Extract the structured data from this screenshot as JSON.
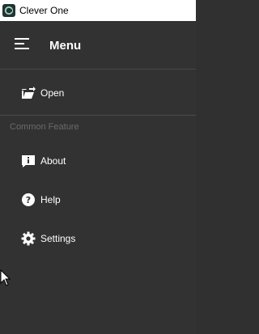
{
  "window": {
    "title": "Clever One"
  },
  "menu": {
    "title": "Menu"
  },
  "items": {
    "open": {
      "label": "Open",
      "icon": "folder-open-icon"
    },
    "about": {
      "label": "About",
      "icon": "info-icon"
    },
    "help": {
      "label": "Help",
      "icon": "help-icon"
    },
    "settings": {
      "label": "Settings",
      "icon": "gear-icon"
    }
  },
  "section": {
    "label": "Common Feature"
  },
  "colors": {
    "background": "#323232",
    "text": "#ffffff",
    "section_text": "#6a6a6a",
    "divider": "#4a4a4a",
    "titlebar": "#ffffff"
  }
}
